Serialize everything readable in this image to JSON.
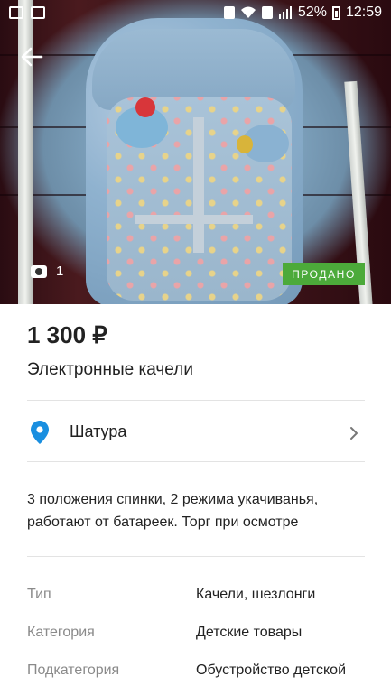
{
  "status_bar": {
    "battery_percent": "52%",
    "time": "12:59"
  },
  "hero": {
    "photo_count": "1",
    "sold_badge": "ПРОДАНО"
  },
  "listing": {
    "price": "1 300 ₽",
    "title": "Электронные качели",
    "location": "Шатура",
    "description": "3 положения спинки, 2 режима укачиванья, работают от батареек. Торг при осмотре"
  },
  "properties": [
    {
      "label": "Тип",
      "value": "Качели, шезлонги"
    },
    {
      "label": "Категория",
      "value": "Детские товары"
    },
    {
      "label": "Подкатегория",
      "value": "Обустройство детской"
    }
  ],
  "colors": {
    "sold_green": "#4caa3a",
    "pin_blue": "#1a8fe0",
    "label_gray": "#8a8a8a"
  }
}
